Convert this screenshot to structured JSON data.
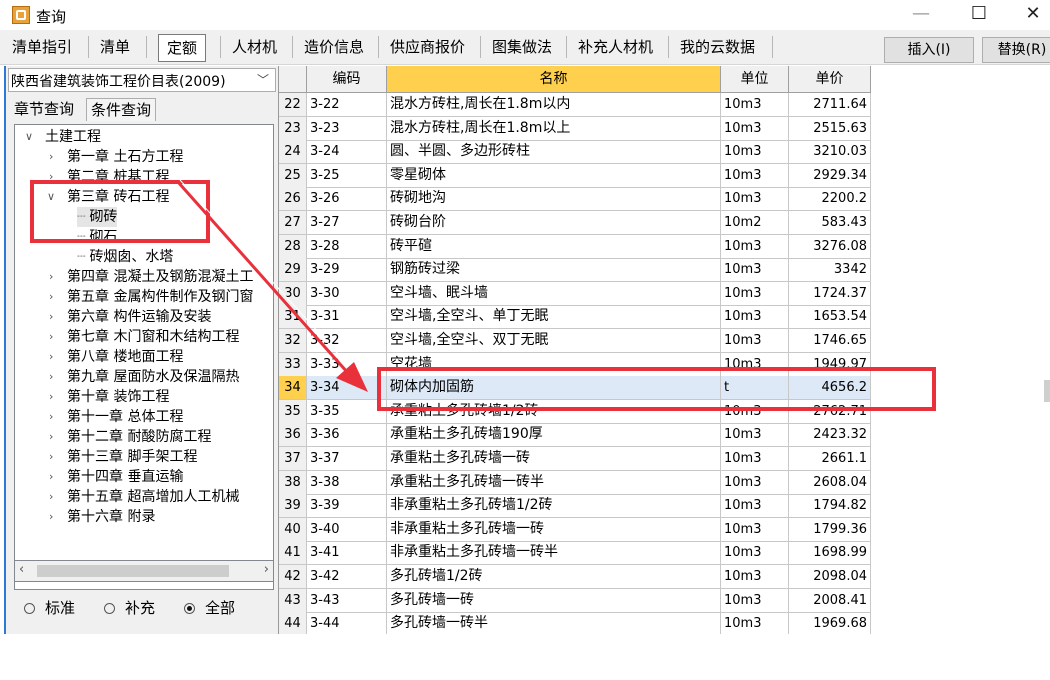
{
  "window": {
    "title": "查询",
    "min": "—",
    "max": "☐",
    "close": "✕"
  },
  "tabs": [
    "清单指引",
    "清单",
    "定额",
    "人材机",
    "造价信息",
    "供应商报价",
    "图集做法",
    "补充人材机",
    "我的云数据"
  ],
  "active_tab": "定额",
  "actions": {
    "insert": "插入(I)",
    "replace": "替换(R)"
  },
  "left": {
    "library": "陕西省建筑装饰工程价目表(2009)",
    "subtabs": [
      "章节查询",
      "条件查询"
    ],
    "tree": [
      "土建工程",
      "第一章 土石方工程",
      "第二章 桩基工程",
      "第三章 砖石工程",
      "砌砖",
      "砌石",
      "砖烟囱、水塔",
      "第四章 混凝土及钢筋混凝土工",
      "第五章 金属构件制作及钢门窗",
      "第六章 构件运输及安装",
      "第七章 木门窗和木结构工程",
      "第八章 楼地面工程",
      "第九章 屋面防水及保温隔热",
      "第十章 装饰工程",
      "第十一章 总体工程",
      "第十二章 耐酸防腐工程",
      "第十三章 脚手架工程",
      "第十四章 垂直运输",
      "第十五章 超高增加人工机械",
      "第十六章 附录"
    ],
    "filters": [
      "标准",
      "补充",
      "全部"
    ],
    "selected_filter": "全部"
  },
  "table": {
    "columns": [
      "编码",
      "名称",
      "单位",
      "单价"
    ],
    "rows": [
      {
        "n": "22",
        "code": "3-22",
        "name": "混水方砖柱,周长在1.8m以内",
        "unit": "10m3",
        "price": "2711.64"
      },
      {
        "n": "23",
        "code": "3-23",
        "name": "混水方砖柱,周长在1.8m以上",
        "unit": "10m3",
        "price": "2515.63"
      },
      {
        "n": "24",
        "code": "3-24",
        "name": "圆、半圆、多边形砖柱",
        "unit": "10m3",
        "price": "3210.03"
      },
      {
        "n": "25",
        "code": "3-25",
        "name": "零星砌体",
        "unit": "10m3",
        "price": "2929.34"
      },
      {
        "n": "26",
        "code": "3-26",
        "name": "砖砌地沟",
        "unit": "10m3",
        "price": "2200.2"
      },
      {
        "n": "27",
        "code": "3-27",
        "name": "砖砌台阶",
        "unit": "10m2",
        "price": "583.43"
      },
      {
        "n": "28",
        "code": "3-28",
        "name": "砖平碹",
        "unit": "10m3",
        "price": "3276.08"
      },
      {
        "n": "29",
        "code": "3-29",
        "name": "钢筋砖过梁",
        "unit": "10m3",
        "price": "3342"
      },
      {
        "n": "30",
        "code": "3-30",
        "name": "空斗墙、眠斗墙",
        "unit": "10m3",
        "price": "1724.37"
      },
      {
        "n": "31",
        "code": "3-31",
        "name": "空斗墙,全空斗、单丁无眠",
        "unit": "10m3",
        "price": "1653.54"
      },
      {
        "n": "32",
        "code": "3-32",
        "name": "空斗墙,全空斗、双丁无眠",
        "unit": "10m3",
        "price": "1746.65"
      },
      {
        "n": "33",
        "code": "3-33",
        "name": "空花墙",
        "unit": "10m3",
        "price": "1949.97"
      },
      {
        "n": "34",
        "code": "3-34",
        "name": "砌体内加固筋",
        "unit": "t",
        "price": "4656.2"
      },
      {
        "n": "35",
        "code": "3-35",
        "name": "承重粘土多孔砖墙1/2砖",
        "unit": "10m3",
        "price": "2762.71"
      },
      {
        "n": "36",
        "code": "3-36",
        "name": "承重粘土多孔砖墙190厚",
        "unit": "10m3",
        "price": "2423.32"
      },
      {
        "n": "37",
        "code": "3-37",
        "name": "承重粘土多孔砖墙一砖",
        "unit": "10m3",
        "price": "2661.1"
      },
      {
        "n": "38",
        "code": "3-38",
        "name": "承重粘土多孔砖墙一砖半",
        "unit": "10m3",
        "price": "2608.04"
      },
      {
        "n": "39",
        "code": "3-39",
        "name": "非承重粘土多孔砖墙1/2砖",
        "unit": "10m3",
        "price": "1794.82"
      },
      {
        "n": "40",
        "code": "3-40",
        "name": "非承重粘土多孔砖墙一砖",
        "unit": "10m3",
        "price": "1799.36"
      },
      {
        "n": "41",
        "code": "3-41",
        "name": "非承重粘土多孔砖墙一砖半",
        "unit": "10m3",
        "price": "1698.99"
      },
      {
        "n": "42",
        "code": "3-42",
        "name": "多孔砖墙1/2砖",
        "unit": "10m3",
        "price": "2098.04"
      },
      {
        "n": "43",
        "code": "3-43",
        "name": "多孔砖墙一砖",
        "unit": "10m3",
        "price": "2008.41"
      },
      {
        "n": "44",
        "code": "3-44",
        "name": "多孔砖墙一砖半",
        "unit": "10m3",
        "price": "1969.68"
      }
    ],
    "selected_row": "34"
  },
  "colors": {
    "header_highlight": "#ffd04d",
    "annotation": "#e8313b",
    "selected_row": "#dde9f7"
  }
}
